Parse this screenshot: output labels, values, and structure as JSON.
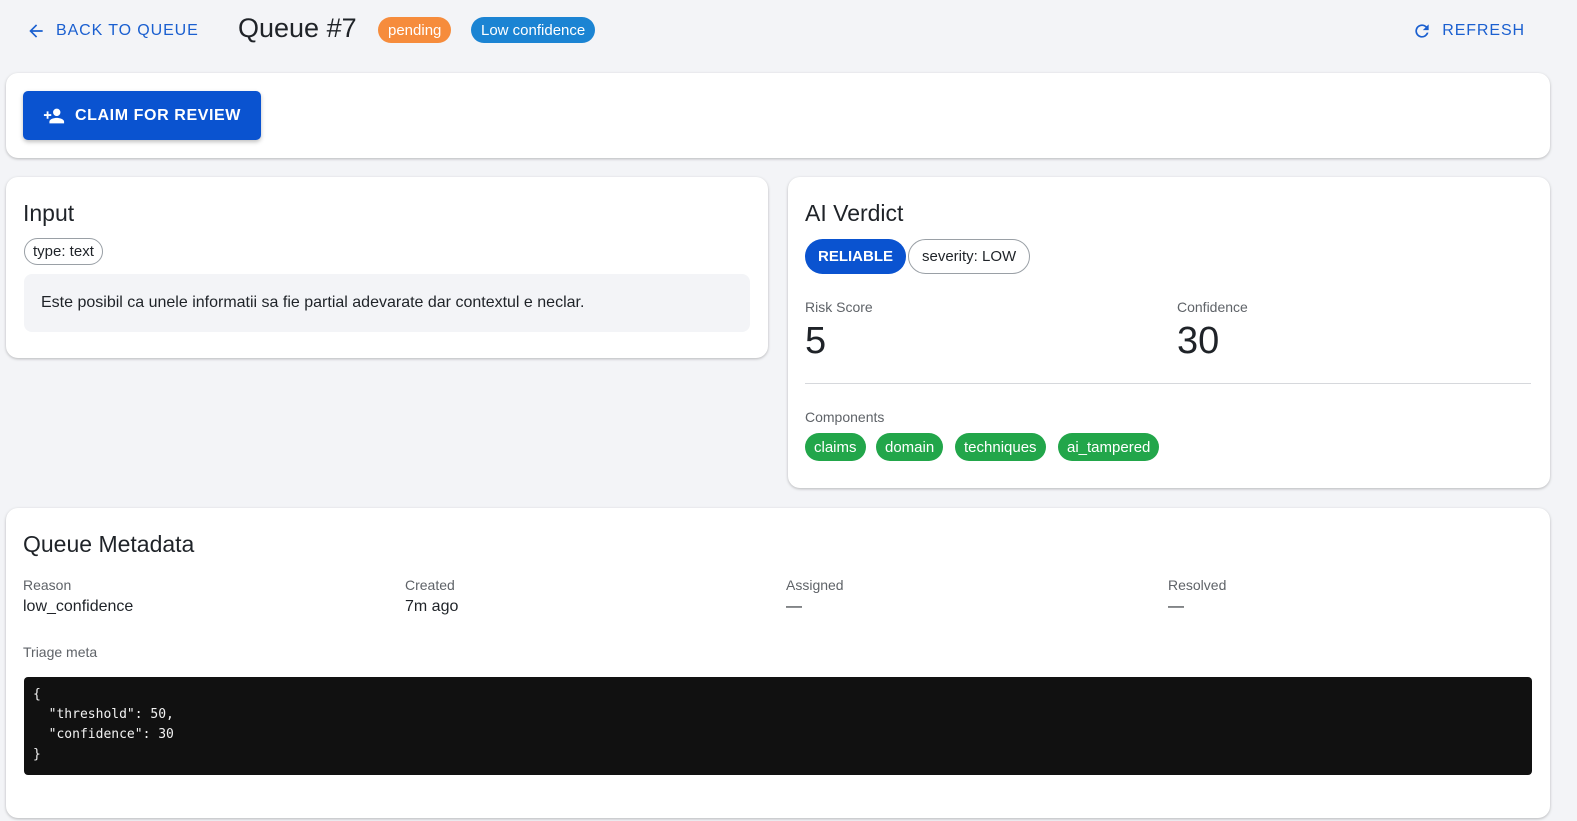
{
  "header": {
    "back_label": "BACK TO QUEUE",
    "title": "Queue #7",
    "status_chip": "pending",
    "confidence_chip": "Low confidence",
    "refresh_label": "REFRESH"
  },
  "actions": {
    "claim_label": "CLAIM FOR REVIEW"
  },
  "input_card": {
    "title": "Input",
    "type_chip": "type: text",
    "text": "Este posibil ca unele informatii sa fie partial adevarate dar contextul e neclar."
  },
  "verdict_card": {
    "title": "AI Verdict",
    "verdict": "RELIABLE",
    "severity": "severity: LOW",
    "risk_label": "Risk Score",
    "risk_value": "5",
    "confidence_label": "Confidence",
    "confidence_value": "30",
    "components_label": "Components",
    "components": [
      "claims",
      "domain",
      "techniques",
      "ai_tampered"
    ]
  },
  "meta_card": {
    "title": "Queue Metadata",
    "reason_label": "Reason",
    "reason_value": "low_confidence",
    "created_label": "Created",
    "created_value": "7m ago",
    "assigned_label": "Assigned",
    "assigned_value": "—",
    "resolved_label": "Resolved",
    "resolved_value": "—",
    "triage_label": "Triage meta",
    "triage_json": "{\n  \"threshold\": 50,\n  \"confidence\": 30\n}"
  },
  "colors": {
    "primary": "#0a53d0",
    "link": "#1a5fd0",
    "pending": "#f68c3c",
    "low_confidence": "#1b84d3",
    "component": "#22a64a",
    "background": "#f3f4f7"
  },
  "icons": {
    "back": "arrow-left-icon",
    "refresh": "refresh-icon",
    "claim": "person-add-icon"
  }
}
